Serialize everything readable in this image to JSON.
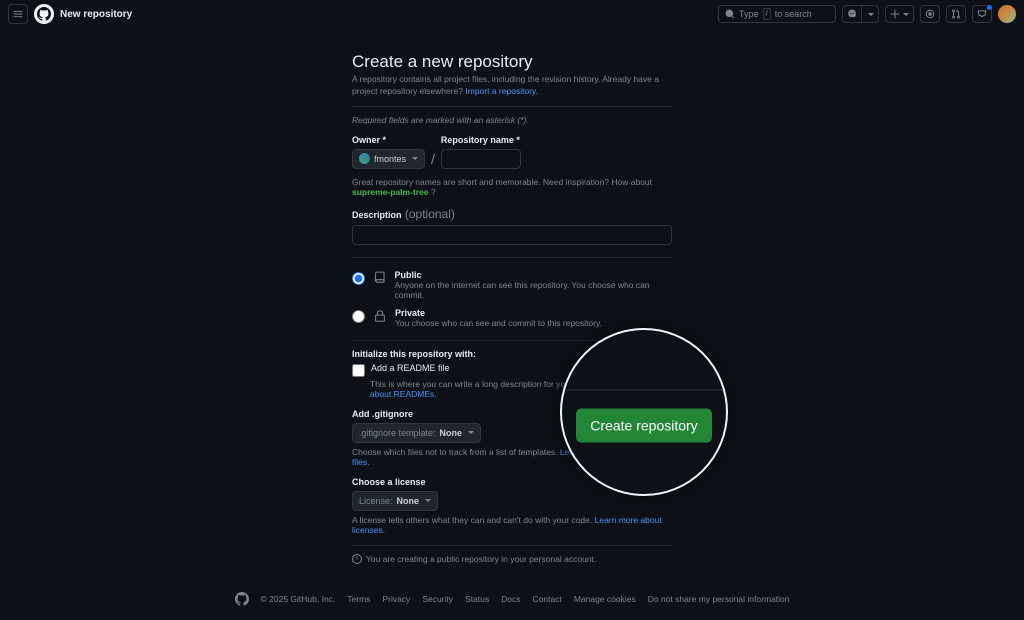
{
  "header": {
    "page_title": "New repository",
    "search_prefix": "Type",
    "search_key": "/",
    "search_suffix": "to search"
  },
  "form": {
    "heading": "Create a new repository",
    "subhead": "A repository contains all project files, including the revision history. Already have a project repository elsewhere? ",
    "import_link": "Import a repository.",
    "required_note": "Required fields are marked with an asterisk (*).",
    "owner_label": "Owner *",
    "owner_value": "fmontes",
    "repo_name_label": "Repository name *",
    "name_hint_pre": "Great repository names are short and memorable. Need inspiration? How about ",
    "name_suggestion": "supreme-palm-tree",
    "name_hint_post": " ?",
    "desc_label": "Description",
    "desc_optional": "(optional)",
    "visibility": {
      "public_title": "Public",
      "public_desc": "Anyone on the internet can see this repository. You choose who can commit.",
      "private_title": "Private",
      "private_desc": "You choose who can see and commit to this repository."
    },
    "init_label": "Initialize this repository with:",
    "readme_label": "Add a README file",
    "readme_desc": "This is where you can write a long description for your project. ",
    "readme_link": "Learn more about READMEs.",
    "gitignore_label": "Add .gitignore",
    "gitignore_btn_pre": ".gitignore template:",
    "gitignore_value": "None",
    "gitignore_desc": "Choose which files not to track from a list of templates. ",
    "gitignore_link": "Learn more about ignoring files.",
    "license_label": "Choose a license",
    "license_btn_pre": "License:",
    "license_value": "None",
    "license_desc": "A license tells others what they can and can't do with your code. ",
    "license_link": "Learn more about licenses.",
    "info_text": "You are creating a public repository in your personal account.",
    "create_button": "Create repository"
  },
  "footer": {
    "copyright": "© 2025 GitHub, Inc.",
    "links": [
      "Terms",
      "Privacy",
      "Security",
      "Status",
      "Docs",
      "Contact",
      "Manage cookies",
      "Do not share my personal information"
    ]
  }
}
